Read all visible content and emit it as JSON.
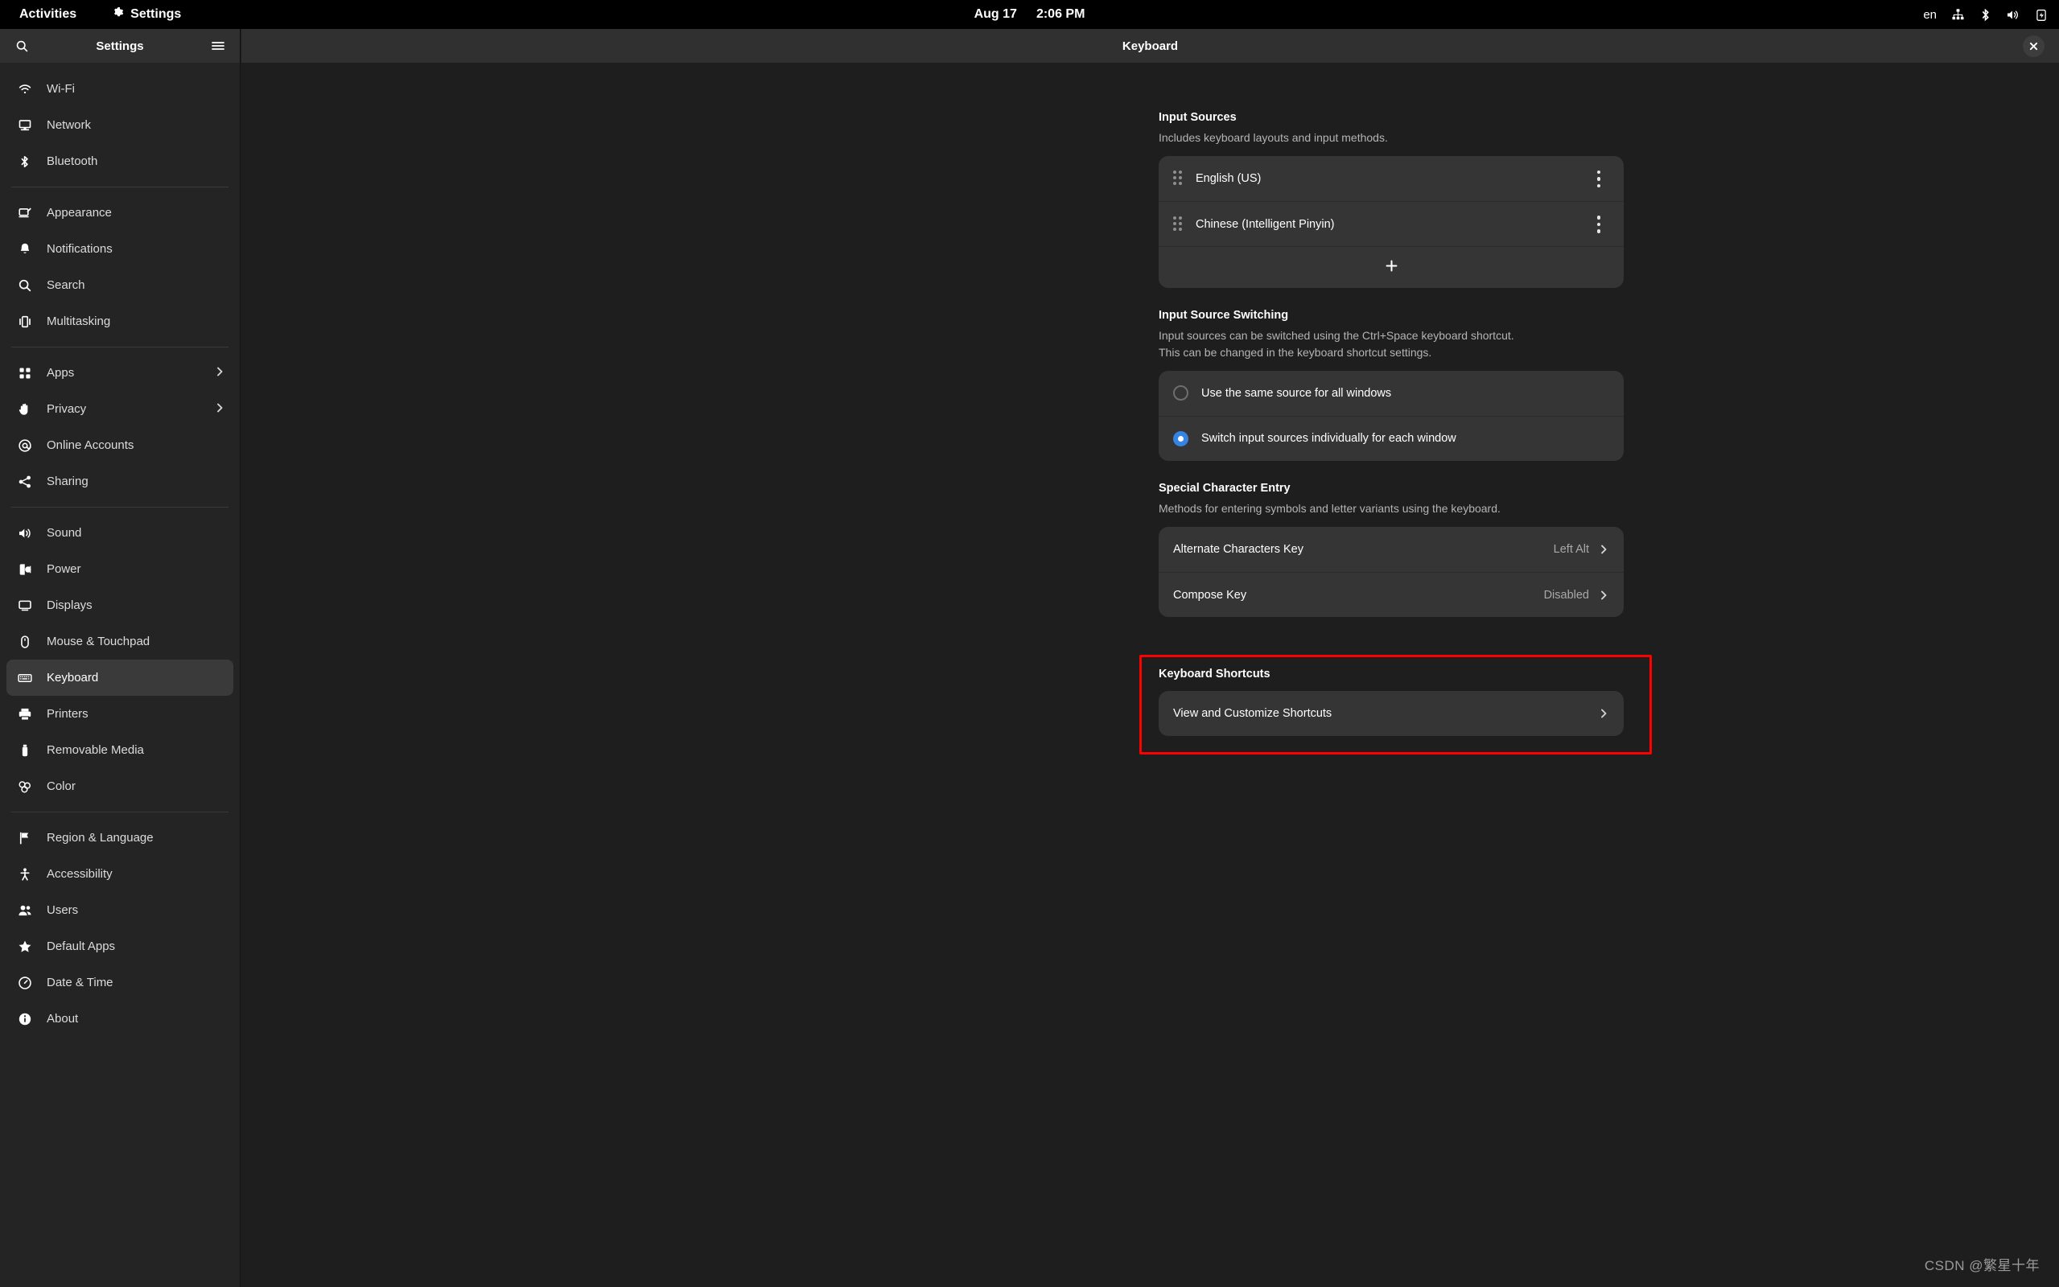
{
  "topbar": {
    "activities": "Activities",
    "app_name": "Settings",
    "app_icon": "gear-icon",
    "date": "Aug 17",
    "time": "2:06 PM",
    "indicators": {
      "input_source": "en",
      "network_icon": "wired-network-icon",
      "bluetooth_icon": "bluetooth-icon",
      "volume_icon": "volume-icon",
      "battery_icon": "battery-charging-icon"
    }
  },
  "sidebar": {
    "title": "Settings",
    "search_icon": "search-icon",
    "menu_icon": "hamburger-menu-icon",
    "groups": [
      {
        "items": [
          {
            "label": "Wi-Fi",
            "icon": "wifi-icon",
            "chevron": false,
            "selected": false
          },
          {
            "label": "Network",
            "icon": "network-icon",
            "chevron": false,
            "selected": false
          },
          {
            "label": "Bluetooth",
            "icon": "bluetooth-icon",
            "chevron": false,
            "selected": false
          }
        ]
      },
      {
        "items": [
          {
            "label": "Appearance",
            "icon": "appearance-icon",
            "chevron": false,
            "selected": false
          },
          {
            "label": "Notifications",
            "icon": "bell-icon",
            "chevron": false,
            "selected": false
          },
          {
            "label": "Search",
            "icon": "search-icon",
            "chevron": false,
            "selected": false
          },
          {
            "label": "Multitasking",
            "icon": "multitasking-icon",
            "chevron": false,
            "selected": false
          }
        ]
      },
      {
        "items": [
          {
            "label": "Apps",
            "icon": "apps-grid-icon",
            "chevron": true,
            "selected": false
          },
          {
            "label": "Privacy",
            "icon": "hand-icon",
            "chevron": true,
            "selected": false
          },
          {
            "label": "Online Accounts",
            "icon": "at-sign-icon",
            "chevron": false,
            "selected": false
          },
          {
            "label": "Sharing",
            "icon": "share-icon",
            "chevron": false,
            "selected": false
          }
        ]
      },
      {
        "items": [
          {
            "label": "Sound",
            "icon": "speaker-icon",
            "chevron": false,
            "selected": false
          },
          {
            "label": "Power",
            "icon": "power-plug-icon",
            "chevron": false,
            "selected": false
          },
          {
            "label": "Displays",
            "icon": "monitor-icon",
            "chevron": false,
            "selected": false
          },
          {
            "label": "Mouse & Touchpad",
            "icon": "mouse-icon",
            "chevron": false,
            "selected": false
          },
          {
            "label": "Keyboard",
            "icon": "keyboard-icon",
            "chevron": false,
            "selected": true
          },
          {
            "label": "Printers",
            "icon": "printer-icon",
            "chevron": false,
            "selected": false
          },
          {
            "label": "Removable Media",
            "icon": "usb-drive-icon",
            "chevron": false,
            "selected": false
          },
          {
            "label": "Color",
            "icon": "color-icon",
            "chevron": false,
            "selected": false
          }
        ]
      },
      {
        "items": [
          {
            "label": "Region & Language",
            "icon": "flag-icon",
            "chevron": false,
            "selected": false
          },
          {
            "label": "Accessibility",
            "icon": "accessibility-icon",
            "chevron": false,
            "selected": false
          },
          {
            "label": "Users",
            "icon": "users-icon",
            "chevron": false,
            "selected": false
          },
          {
            "label": "Default Apps",
            "icon": "star-icon",
            "chevron": false,
            "selected": false
          },
          {
            "label": "Date & Time",
            "icon": "clock-icon",
            "chevron": false,
            "selected": false
          },
          {
            "label": "About",
            "icon": "info-icon",
            "chevron": false,
            "selected": false
          }
        ]
      }
    ]
  },
  "main": {
    "title": "Keyboard",
    "close_icon": "close-icon",
    "input_sources": {
      "title": "Input Sources",
      "description": "Includes keyboard layouts and input methods.",
      "items": [
        {
          "label": "English (US)",
          "handle_icon": "drag-handle-icon",
          "menu_icon": "more-options-icon"
        },
        {
          "label": "Chinese (Intelligent Pinyin)",
          "handle_icon": "drag-handle-icon",
          "menu_icon": "more-options-icon"
        }
      ],
      "add_icon": "plus-icon"
    },
    "input_source_switching": {
      "title": "Input Source Switching",
      "description_line1": "Input sources can be switched using the Ctrl+Space keyboard shortcut.",
      "description_line2": "This can be changed in the keyboard shortcut settings.",
      "options": [
        {
          "label": "Use the same source for all windows",
          "selected": false
        },
        {
          "label": "Switch input sources individually for each window",
          "selected": true
        }
      ]
    },
    "special_character_entry": {
      "title": "Special Character Entry",
      "description": "Methods for entering symbols and letter variants using the keyboard.",
      "rows": [
        {
          "label": "Alternate Characters Key",
          "value": "Left Alt",
          "chevron_icon": "chevron-right-icon"
        },
        {
          "label": "Compose Key",
          "value": "Disabled",
          "chevron_icon": "chevron-right-icon"
        }
      ]
    },
    "keyboard_shortcuts": {
      "title": "Keyboard Shortcuts",
      "row": {
        "label": "View and Customize Shortcuts",
        "chevron_icon": "chevron-right-icon"
      },
      "highlight_color": "#ff0000"
    }
  },
  "watermark": "CSDN @繁星十年",
  "colors": {
    "accent": "#3584e4",
    "topbar_bg": "#000000",
    "sidebar_bg": "#242424",
    "header_bg": "#303030",
    "content_bg": "#1e1e1e",
    "card_bg": "#353535",
    "highlight": "#ff0000"
  }
}
